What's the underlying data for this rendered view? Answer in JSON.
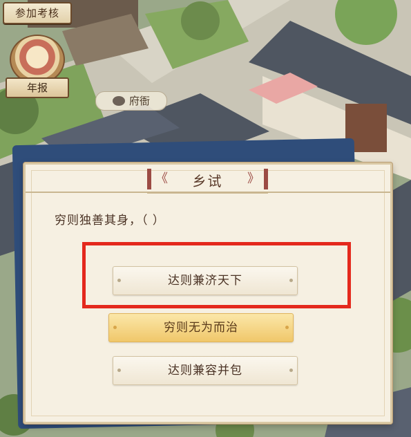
{
  "hud": {
    "exam_button": "参加考核",
    "annual_report": "年报",
    "location": "府衙"
  },
  "dialog": {
    "title": "乡试",
    "title_deco_left": "《",
    "title_deco_right": "》",
    "question": "穷则独善其身，（    ）",
    "options": [
      {
        "label": "达则兼济天下",
        "style": "normal"
      },
      {
        "label": "穷则无为而治",
        "style": "gold"
      },
      {
        "label": "达则兼容并包",
        "style": "normal"
      }
    ]
  },
  "colors": {
    "highlight": "#e4291d",
    "dialog_bg": "#f6f0e2",
    "roof": "#4f5661"
  },
  "icons": [
    "annual-report-icon",
    "location-pin-icon"
  ]
}
